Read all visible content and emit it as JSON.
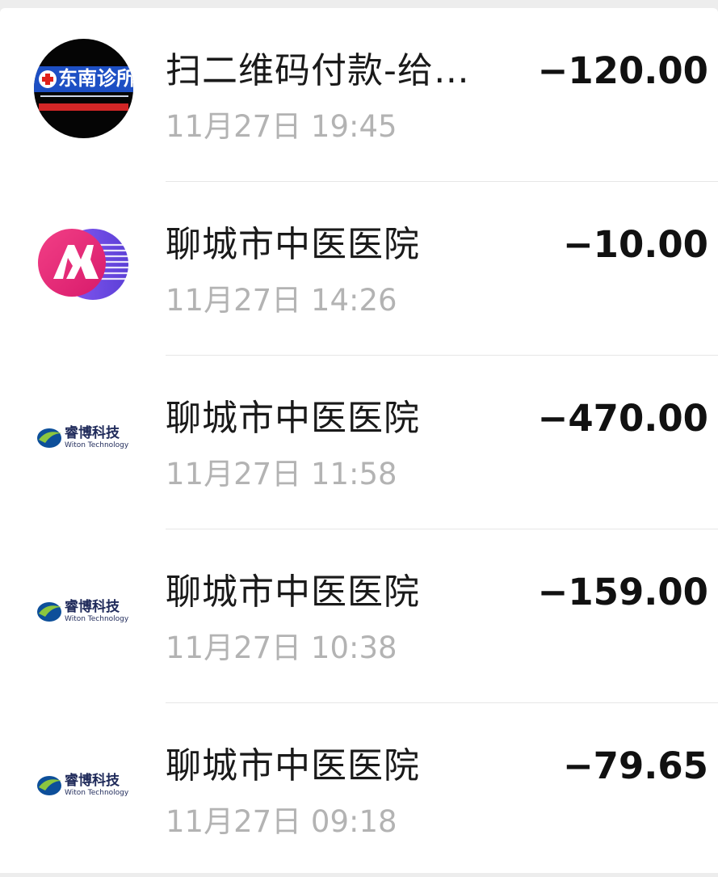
{
  "transactions": [
    {
      "avatar": "dongnan-clinic-logo",
      "avatar_text": "东南诊所",
      "title": "扫二维码付款-给…",
      "time": "11月27日 19:45",
      "amount": "−120.00"
    },
    {
      "avatar": "bank-m-logo",
      "title": "聊城市中医医院",
      "time": "11月27日 14:26",
      "amount": "−10.00"
    },
    {
      "avatar": "witon-technology-logo",
      "avatar_text": "睿博科技",
      "avatar_subtext": "Witon Technology",
      "title": "聊城市中医医院",
      "time": "11月27日 11:58",
      "amount": "−470.00"
    },
    {
      "avatar": "witon-technology-logo",
      "avatar_text": "睿博科技",
      "avatar_subtext": "Witon Technology",
      "title": "聊城市中医医院",
      "time": "11月27日 10:38",
      "amount": "−159.00"
    },
    {
      "avatar": "witon-technology-logo",
      "avatar_text": "睿博科技",
      "avatar_subtext": "Witon Technology",
      "title": "聊城市中医医院",
      "time": "11月27日 09:18",
      "amount": "−79.65"
    }
  ],
  "colors": {
    "background": "#ededed",
    "card": "#ffffff",
    "title": "#1a1a1a",
    "time": "#b3b3b3",
    "amount": "#111111",
    "divider": "#e6e6e6"
  }
}
